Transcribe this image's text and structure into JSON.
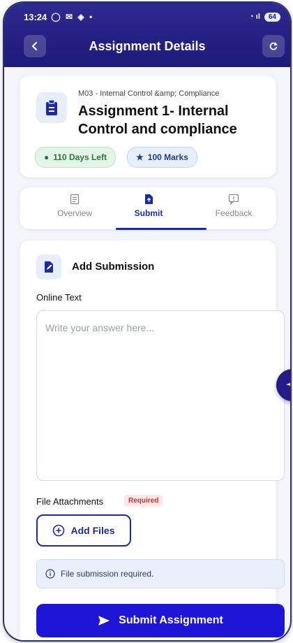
{
  "status_bar": {
    "time": "13:24",
    "battery": "64"
  },
  "header": {
    "title": "Assignment Details"
  },
  "assignment": {
    "module": "M03 - Internal Control &amp; Compliance",
    "title": "Assignment 1- Internal Control and compliance",
    "days_left": "110 Days Left",
    "marks": "100 Marks"
  },
  "tabs": [
    {
      "label": "Overview",
      "active": false
    },
    {
      "label": "Submit",
      "active": true
    },
    {
      "label": "Feedback",
      "active": false
    }
  ],
  "submission": {
    "heading": "Add Submission",
    "online_text_label": "Online Text",
    "answer_placeholder": "Write your answer here...",
    "answer_value": "",
    "file_attachments_label": "File Attachments",
    "required_badge": "Required",
    "add_files_label": "Add Files",
    "notice": "File submission required.",
    "submit_label": "Submit Assignment"
  },
  "colors": {
    "primary": "#1d16d6",
    "header": "#1c1a7a",
    "success": "#2b7a3a",
    "danger": "#c43434"
  }
}
